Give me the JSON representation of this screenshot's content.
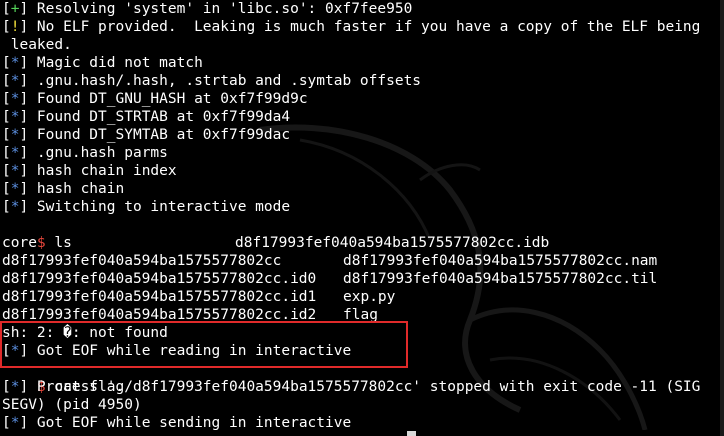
{
  "terminal": {
    "lines": [
      {
        "tag": "+",
        "tag_color": "g",
        "text": " Resolving 'system' in 'libc.so': 0xf7fee950"
      },
      {
        "tag": "!",
        "tag_color": "y",
        "text": " No ELF provided.  Leaking is much faster if you have a copy of the ELF being"
      },
      {
        "tag": "",
        "tag_color": "",
        "text": " leaked."
      },
      {
        "tag": "*",
        "tag_color": "b",
        "text": " Magic did not match"
      },
      {
        "tag": "*",
        "tag_color": "b",
        "text": " .gnu.hash/.hash, .strtab and .symtab offsets"
      },
      {
        "tag": "*",
        "tag_color": "b",
        "text": " Found DT_GNU_HASH at 0xf7f99d9c"
      },
      {
        "tag": "*",
        "tag_color": "b",
        "text": " Found DT_STRTAB at 0xf7f99da4"
      },
      {
        "tag": "*",
        "tag_color": "b",
        "text": " Found DT_SYMTAB at 0xf7f99dac"
      },
      {
        "tag": "*",
        "tag_color": "b",
        "text": " .gnu.hash parms"
      },
      {
        "tag": "*",
        "tag_color": "b",
        "text": " hash chain index"
      },
      {
        "tag": "*",
        "tag_color": "b",
        "text": " hash chain"
      },
      {
        "tag": "*",
        "tag_color": "b",
        "text": " Switching to interactive mode"
      }
    ],
    "prompt_symbol": "$",
    "cmd_ls": "ls",
    "ls_rows": [
      {
        "left": "core",
        "right": "d8f17993fef040a594ba1575577802cc.idb"
      },
      {
        "left": "d8f17993fef040a594ba1575577802cc",
        "right": "d8f17993fef040a594ba1575577802cc.nam"
      },
      {
        "left": "d8f17993fef040a594ba1575577802cc.id0",
        "right": "d8f17993fef040a594ba1575577802cc.til"
      },
      {
        "left": "d8f17993fef040a594ba1575577802cc.id1",
        "right": "exp.py"
      },
      {
        "left": "d8f17993fef040a594ba1575577802cc.id2",
        "right": "flag"
      }
    ],
    "sh_error": "sh: 2: �: not found",
    "eof_reading": " Got EOF while reading in interactive",
    "cmd_cat": "cat flag",
    "process_stop_1": " Process './d8f17993fef040a594ba1575577802cc' stopped with exit code -11 (SIG",
    "process_stop_2": "SEGV) (pid 4950)",
    "eof_sending": " Got EOF while sending in interactive",
    "star_tag": "*"
  },
  "colors": {
    "background": "#000000",
    "green": "#55d35a",
    "red": "#e2453b",
    "yellow": "#f2df3a",
    "blue": "#5c8fe0",
    "highlight_border": "#e02a2a"
  }
}
